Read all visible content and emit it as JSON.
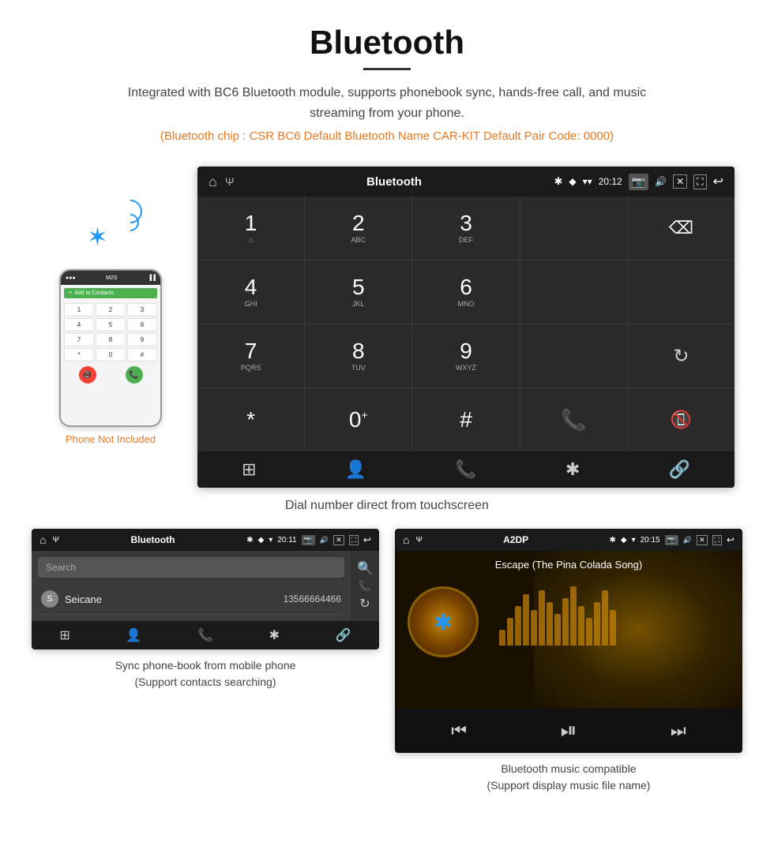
{
  "page": {
    "title": "Bluetooth",
    "description": "Integrated with BC6 Bluetooth module, supports phonebook sync, hands-free call, and music streaming from your phone.",
    "chip_info": "(Bluetooth chip : CSR BC6    Default Bluetooth Name CAR-KIT    Default Pair Code: 0000)"
  },
  "big_screen": {
    "status_bar": {
      "app_name": "Bluetooth",
      "time": "20:12"
    },
    "dialpad": [
      {
        "key": "1",
        "sub": "⌂"
      },
      {
        "key": "2",
        "sub": "ABC"
      },
      {
        "key": "3",
        "sub": "DEF"
      },
      {
        "key": "",
        "sub": ""
      },
      {
        "key": "⌫",
        "sub": ""
      },
      {
        "key": "4",
        "sub": "GHI"
      },
      {
        "key": "5",
        "sub": "JKL"
      },
      {
        "key": "6",
        "sub": "MNO"
      },
      {
        "key": "",
        "sub": ""
      },
      {
        "key": "",
        "sub": ""
      },
      {
        "key": "7",
        "sub": "PQRS"
      },
      {
        "key": "8",
        "sub": "TUV"
      },
      {
        "key": "9",
        "sub": "WXYZ"
      },
      {
        "key": "",
        "sub": ""
      },
      {
        "key": "↻",
        "sub": ""
      },
      {
        "key": "*",
        "sub": ""
      },
      {
        "key": "0",
        "sub": "+"
      },
      {
        "key": "#",
        "sub": ""
      },
      {
        "key": "📞",
        "sub": ""
      },
      {
        "key": "📵",
        "sub": ""
      }
    ],
    "nav_icons": [
      "⊞",
      "👤",
      "📞",
      "✱",
      "🔗"
    ],
    "caption": "Dial number direct from touchscreen"
  },
  "phonebook_screen": {
    "status_bar": {
      "app_name": "Bluetooth",
      "time": "20:11"
    },
    "search_placeholder": "Search",
    "contacts": [
      {
        "initial": "S",
        "name": "Seicane",
        "number": "13566664466"
      }
    ],
    "caption_line1": "Sync phone-book from mobile phone",
    "caption_line2": "(Support contacts searching)"
  },
  "music_screen": {
    "status_bar": {
      "app_name": "A2DP",
      "time": "20:15"
    },
    "song_name": "Escape (The Pina Colada Song)",
    "eq_bars": [
      20,
      35,
      50,
      65,
      45,
      70,
      55,
      40,
      60,
      75,
      50,
      35,
      55,
      70,
      45
    ],
    "caption_line1": "Bluetooth music compatible",
    "caption_line2": "(Support display music file name)"
  },
  "phone_illustration": {
    "not_included_text": "Phone Not Included"
  },
  "icons": {
    "home": "⌂",
    "bluetooth": "✱",
    "usb": "Ψ",
    "back": "↩",
    "close": "✕",
    "minimize": "—",
    "fullscreen": "⛶",
    "camera": "📷",
    "volume": "🔊",
    "wifi": "▾",
    "signal": "▾",
    "location": "◆",
    "search": "🔍",
    "phone": "📞",
    "refresh": "↻",
    "link": "🔗",
    "person": "👤",
    "grid": "⊞",
    "prev": "⏮",
    "play_pause": "⏯",
    "next": "⏭"
  }
}
